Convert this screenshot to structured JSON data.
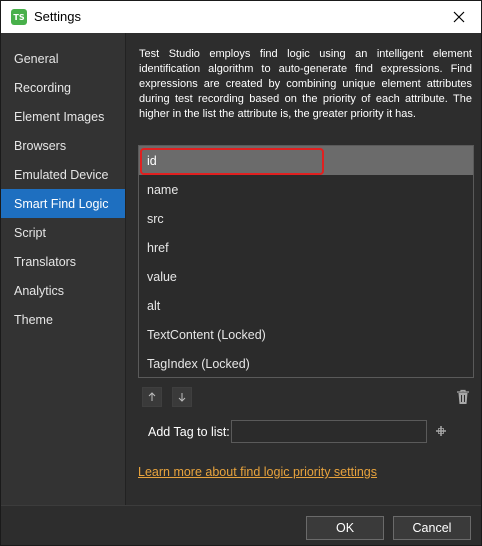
{
  "window": {
    "title": "Settings",
    "app_icon_text": "TS"
  },
  "sidebar": {
    "items": [
      {
        "label": "General"
      },
      {
        "label": "Recording"
      },
      {
        "label": "Element Images"
      },
      {
        "label": "Browsers"
      },
      {
        "label": "Emulated Device"
      },
      {
        "label": "Smart Find Logic"
      },
      {
        "label": "Script"
      },
      {
        "label": "Translators"
      },
      {
        "label": "Analytics"
      },
      {
        "label": "Theme"
      }
    ],
    "active_index": 5
  },
  "main": {
    "description": "Test Studio employs find logic using an intelligent element identification algorithm to auto-generate find expressions. Find expressions are created by combining unique element attributes during test recording based on the priority of each attribute. The higher in the list the attribute is, the greater priority it has.",
    "attributes": [
      {
        "label": "id"
      },
      {
        "label": "name"
      },
      {
        "label": "src"
      },
      {
        "label": "href"
      },
      {
        "label": "value"
      },
      {
        "label": "alt"
      },
      {
        "label": "TextContent (Locked)"
      },
      {
        "label": "TagIndex (Locked)"
      }
    ],
    "selected_index": 0,
    "add_tag_label": "Add Tag to list:",
    "add_tag_value": "",
    "learn_more_link": "Learn more about find logic priority settings"
  },
  "footer": {
    "ok_label": "OK",
    "cancel_label": "Cancel"
  },
  "colors": {
    "accent": "#1e6fc0",
    "highlight": "#e02020",
    "link": "#e8a33d",
    "app_icon": "#48b04a"
  },
  "icons": {
    "up": "arrow-up-icon",
    "down": "arrow-down-icon",
    "delete": "trash-icon",
    "add": "plus-icon",
    "close": "close-icon"
  }
}
